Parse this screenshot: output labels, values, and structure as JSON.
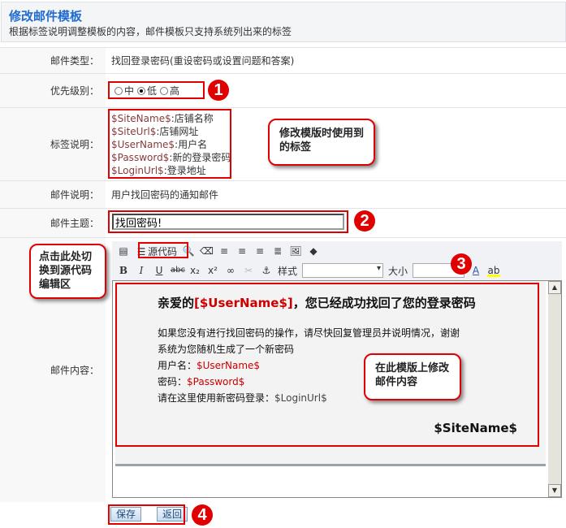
{
  "header": {
    "title": "修改邮件模板",
    "subtitle": "根据标签说明调整模板的内容，邮件模板只支持系统列出来的标签"
  },
  "rows": {
    "type": {
      "label": "邮件类型：",
      "value": "找回登录密码(重设密码或设置问题和答案)"
    },
    "priority": {
      "label": "优先级别：",
      "options": [
        "中",
        "低",
        "高"
      ],
      "selected": "低"
    },
    "tags": {
      "label": "标签说明：",
      "items": [
        {
          "tag": "$SiteName$",
          "desc": ":店铺名称"
        },
        {
          "tag": "$SiteUrl$",
          "desc": ":店铺网址"
        },
        {
          "tag": "$UserName$",
          "desc": ":用户名"
        },
        {
          "tag": "$Password$",
          "desc": ":新的登录密码"
        },
        {
          "tag": "$LoginUrl$",
          "desc": ":登录地址"
        }
      ]
    },
    "desc": {
      "label": "邮件说明：",
      "value": "用户找回密码的通知邮件"
    },
    "subject": {
      "label": "邮件主题：",
      "value": "找回密码!"
    },
    "content": {
      "label": "邮件内容："
    }
  },
  "toolbar": {
    "source_label": "源代码",
    "style_label": "样式",
    "size_label": "大小"
  },
  "editor": {
    "greeting_pre": "亲爱的",
    "greeting_tag": "[$UserName$]",
    "greeting_post": "，您已经成功找回了您的登录密码",
    "line1": "如果您没有进行找回密码的操作，请尽快回复管理员并说明情况，谢谢",
    "line2": "系统为您随机生成了一个新密码",
    "user_label": "用户名：",
    "user_tag": "$UserName$",
    "pwd_label": "密码：",
    "pwd_tag": "$Password$",
    "login_label": "请在这里使用新密码登录：",
    "login_tag": "$LoginUrl$",
    "signature": "$SiteName$"
  },
  "callouts": {
    "tags": "修改模版时使用到的标签",
    "source": "点击此处切换到源代码编辑区",
    "content": "在此模版上修改邮件内容"
  },
  "markers": [
    "1",
    "2",
    "3",
    "4"
  ],
  "buttons": {
    "save": "保存",
    "back": "返回"
  },
  "colors": {
    "accent": "#1f6bcf",
    "highlight": "#e00000",
    "tag": "#8a3a3a"
  }
}
